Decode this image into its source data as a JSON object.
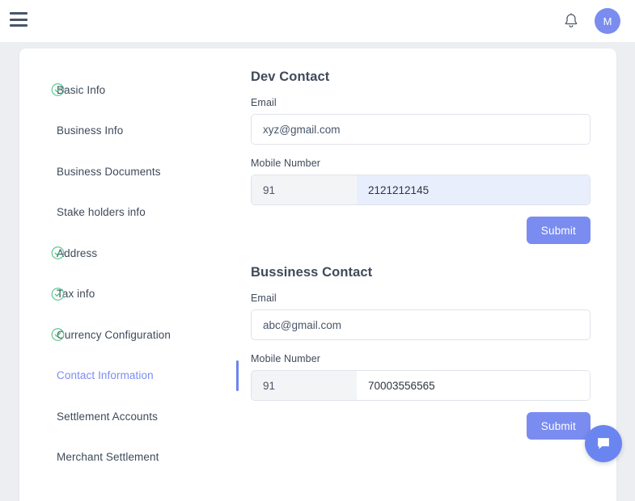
{
  "topbar": {
    "menu_icon": "hamburger-menu-icon",
    "notification_icon": "bell-icon",
    "avatar_initial": "M"
  },
  "stepper": {
    "items": [
      {
        "label": "Basic Info",
        "completed": true,
        "active": false
      },
      {
        "label": "Business Info",
        "completed": false,
        "active": false
      },
      {
        "label": "Business Documents",
        "completed": false,
        "active": false
      },
      {
        "label": "Stake holders info",
        "completed": false,
        "active": false
      },
      {
        "label": "Address",
        "completed": true,
        "active": false
      },
      {
        "label": "Tax info",
        "completed": true,
        "active": false
      },
      {
        "label": "Currency Configuration",
        "completed": true,
        "active": false
      },
      {
        "label": "Contact Information",
        "completed": false,
        "active": true
      },
      {
        "label": "Settlement Accounts",
        "completed": false,
        "active": false
      },
      {
        "label": "Merchant Settlement",
        "completed": false,
        "active": false
      }
    ]
  },
  "form": {
    "dev_contact": {
      "title": "Dev Contact",
      "email_label": "Email",
      "email_value": "xyz@gmail.com",
      "mobile_label": "Mobile Number",
      "mobile_prefix": "91",
      "mobile_value": "2121212145",
      "submit_label": "Submit"
    },
    "business_contact": {
      "title": "Bussiness Contact",
      "email_label": "Email",
      "email_value": "abc@gmail.com",
      "mobile_label": "Mobile Number",
      "mobile_prefix": "91",
      "mobile_value": "70003556565",
      "submit_label": "Submit"
    }
  },
  "chat": {
    "icon": "chat-bubble-icon"
  },
  "colors": {
    "accent": "#7b8cf0",
    "accent_strong": "#6b85f0",
    "check_green": "#4cc38a",
    "page_background": "#eceef2",
    "card_background": "#ffffff",
    "autofill_background": "#e8eefc",
    "prefix_background": "#f3f4f6",
    "text": "#3f4a5a",
    "border": "#dfe3eb"
  }
}
